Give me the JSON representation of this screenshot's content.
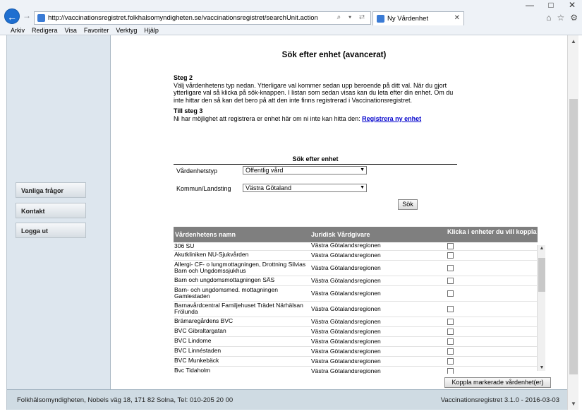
{
  "browser": {
    "url": "http://vaccinationsregistret.folkhalsomyndigheten.se/vaccinationsregistret/searchUnit.action",
    "address_tools": "⌕ ▾ ⇄",
    "tab_title": "Ny Vårdenhet",
    "menu": [
      "Arkiv",
      "Redigera",
      "Visa",
      "Favoriter",
      "Verktyg",
      "Hjälp"
    ]
  },
  "sidebar": {
    "items": [
      {
        "label": "Vanliga frågor"
      },
      {
        "label": "Kontakt"
      },
      {
        "label": "Logga ut"
      }
    ]
  },
  "page": {
    "title": "Sök efter enhet (avancerat)",
    "step2_heading": "Steg 2",
    "step2_text": "Välj vårdenhetens typ nedan. Ytterligare val kommer sedan upp beroende på ditt val. När du gjort ytterligare val så klicka på sök-knappen. I listan som sedan visas kan du leta efter din enhet. Om du inte hittar den så kan det bero på att den inte finns registrerad i Vaccinationsregistret.",
    "step3_heading": "Till steg 3",
    "step3_text": "Ni har möjlighet att registrera er enhet här om ni inte kan hitta den:",
    "register_link": "Registrera ny enhet"
  },
  "form": {
    "title": "Sök efter enhet",
    "type_label": "Vårdenhetstyp",
    "type_value": "Offentlig vård",
    "region_label": "Kommun/Landsting",
    "region_value": "Västra Götaland",
    "search_button": "Sök"
  },
  "table": {
    "headers": [
      "Vårdenhetens namn",
      "Juridisk Vårdgivare",
      "Klicka i enheter du vill koppla"
    ],
    "rows": [
      {
        "name": "306 SU",
        "provider": "Västra Götalandsregionen"
      },
      {
        "name": "Akutkliniken NU-Sjukvården",
        "provider": "Västra Götalandsregionen"
      },
      {
        "name": "Allergi- CF- o lungmottagningen, Drottning Silvias Barn och Ungdomssjukhus",
        "provider": "Västra Götalandsregionen"
      },
      {
        "name": "Barn och ungdomsmottagningen SÄS",
        "provider": "Västra Götalandsregionen"
      },
      {
        "name": "Barn- och ungdomsmed. mottagningen Gamlestaden",
        "provider": "Västra Götalandsregionen"
      },
      {
        "name": "Barnavårdcentral Familjehuset Trädet Närhälsan Frölunda",
        "provider": "Västra Götalandsregionen"
      },
      {
        "name": "Brämaregårdens BVC",
        "provider": "Västra Götalandsregionen"
      },
      {
        "name": "BVC Gibraltargatan",
        "provider": "Västra Götalandsregionen"
      },
      {
        "name": "BVC Lindome",
        "provider": "Västra Götalandsregionen"
      },
      {
        "name": "BVC Linnéstaden",
        "provider": "Västra Götalandsregionen"
      },
      {
        "name": "BVC Munkebäck",
        "provider": "Västra Götalandsregionen"
      },
      {
        "name": "Bvc Tidaholm",
        "provider": "Västra Götalandsregionen"
      }
    ],
    "connect_button": "Koppla markerade vårdenhet(er)"
  },
  "footer": {
    "left": "Folkhälsomyndigheten, Nobels väg 18, 171 82 Solna, Tel: 010-205 20 00",
    "right": "Vaccinationsregistret 3.1.0 - 2016-03-03"
  }
}
